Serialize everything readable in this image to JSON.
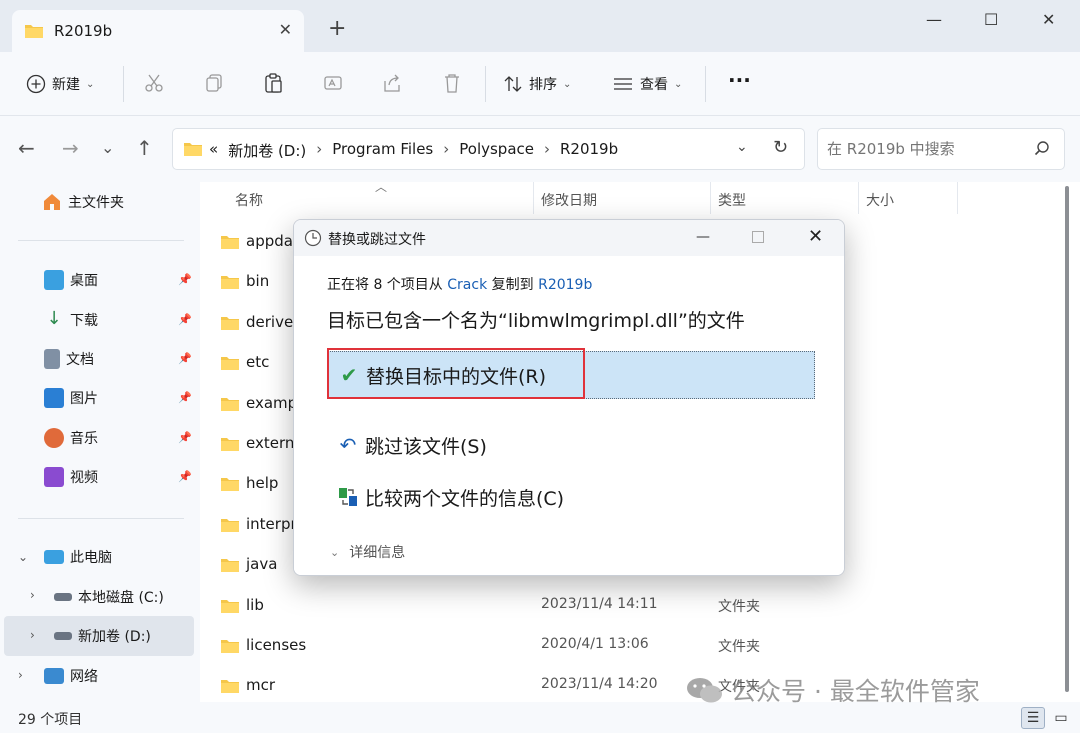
{
  "window": {
    "tab_title": "R2019b",
    "new_tab": "+",
    "minimize": "—",
    "maximize": "☐",
    "close": "✕"
  },
  "toolbar": {
    "new_label": "新建",
    "sort_label": "排序",
    "view_label": "查看",
    "more": "···"
  },
  "address": {
    "crumbs": [
      "«",
      "新加卷 (D:)",
      "Program Files",
      "Polyspace",
      "R2019b"
    ],
    "search_placeholder": "在 R2019b 中搜索"
  },
  "sidebar": {
    "home": "主文件夹",
    "quick": [
      {
        "label": "桌面",
        "icon": "desktop-icon",
        "color": "#3aa0e0"
      },
      {
        "label": "下载",
        "icon": "download-icon",
        "color": "#2d8a4f"
      },
      {
        "label": "文档",
        "icon": "document-icon",
        "color": "#6c7a8c"
      },
      {
        "label": "图片",
        "icon": "picture-icon",
        "color": "#2a7fd4"
      },
      {
        "label": "音乐",
        "icon": "music-icon",
        "color": "#e06a3a"
      },
      {
        "label": "视频",
        "icon": "video-icon",
        "color": "#8a4bd0"
      }
    ],
    "this_pc": "此电脑",
    "drive_c": "本地磁盘 (C:)",
    "drive_d": "新加卷 (D:)",
    "network": "网络"
  },
  "columns": {
    "name": "名称",
    "modified": "修改日期",
    "type": "类型",
    "size": "大小"
  },
  "files": [
    {
      "name": "appdata",
      "date": "",
      "type": ""
    },
    {
      "name": "bin",
      "date": "",
      "type": ""
    },
    {
      "name": "derived",
      "date": "",
      "type": ""
    },
    {
      "name": "etc",
      "date": "",
      "type": ""
    },
    {
      "name": "examples",
      "date": "",
      "type": ""
    },
    {
      "name": "extern",
      "date": "",
      "type": ""
    },
    {
      "name": "help",
      "date": "",
      "type": ""
    },
    {
      "name": "interprocess",
      "date": "",
      "type": ""
    },
    {
      "name": "java",
      "date": "",
      "type": ""
    },
    {
      "name": "lib",
      "date": "2023/11/4 14:11",
      "type": "文件夹"
    },
    {
      "name": "licenses",
      "date": "2020/4/1 13:06",
      "type": "文件夹"
    },
    {
      "name": "mcr",
      "date": "2023/11/4 14:20",
      "type": "文件夹"
    }
  ],
  "status": {
    "count": "29 个项目"
  },
  "watermark": "公众号 · 最全软件管家",
  "dialog": {
    "title": "替换或跳过文件",
    "line1_prefix": "正在将 8 个项目从",
    "line1_source": "Crack",
    "line1_mid": "复制到",
    "line1_dest": "R2019b",
    "line2": "目标已包含一个名为“libmwlmgrimpl.dll”的文件",
    "opt_replace": "替换目标中的文件(R)",
    "opt_skip": "跳过该文件(S)",
    "opt_compare": "比较两个文件的信息(C)",
    "details": "详细信息",
    "accent": "#e0323a"
  }
}
